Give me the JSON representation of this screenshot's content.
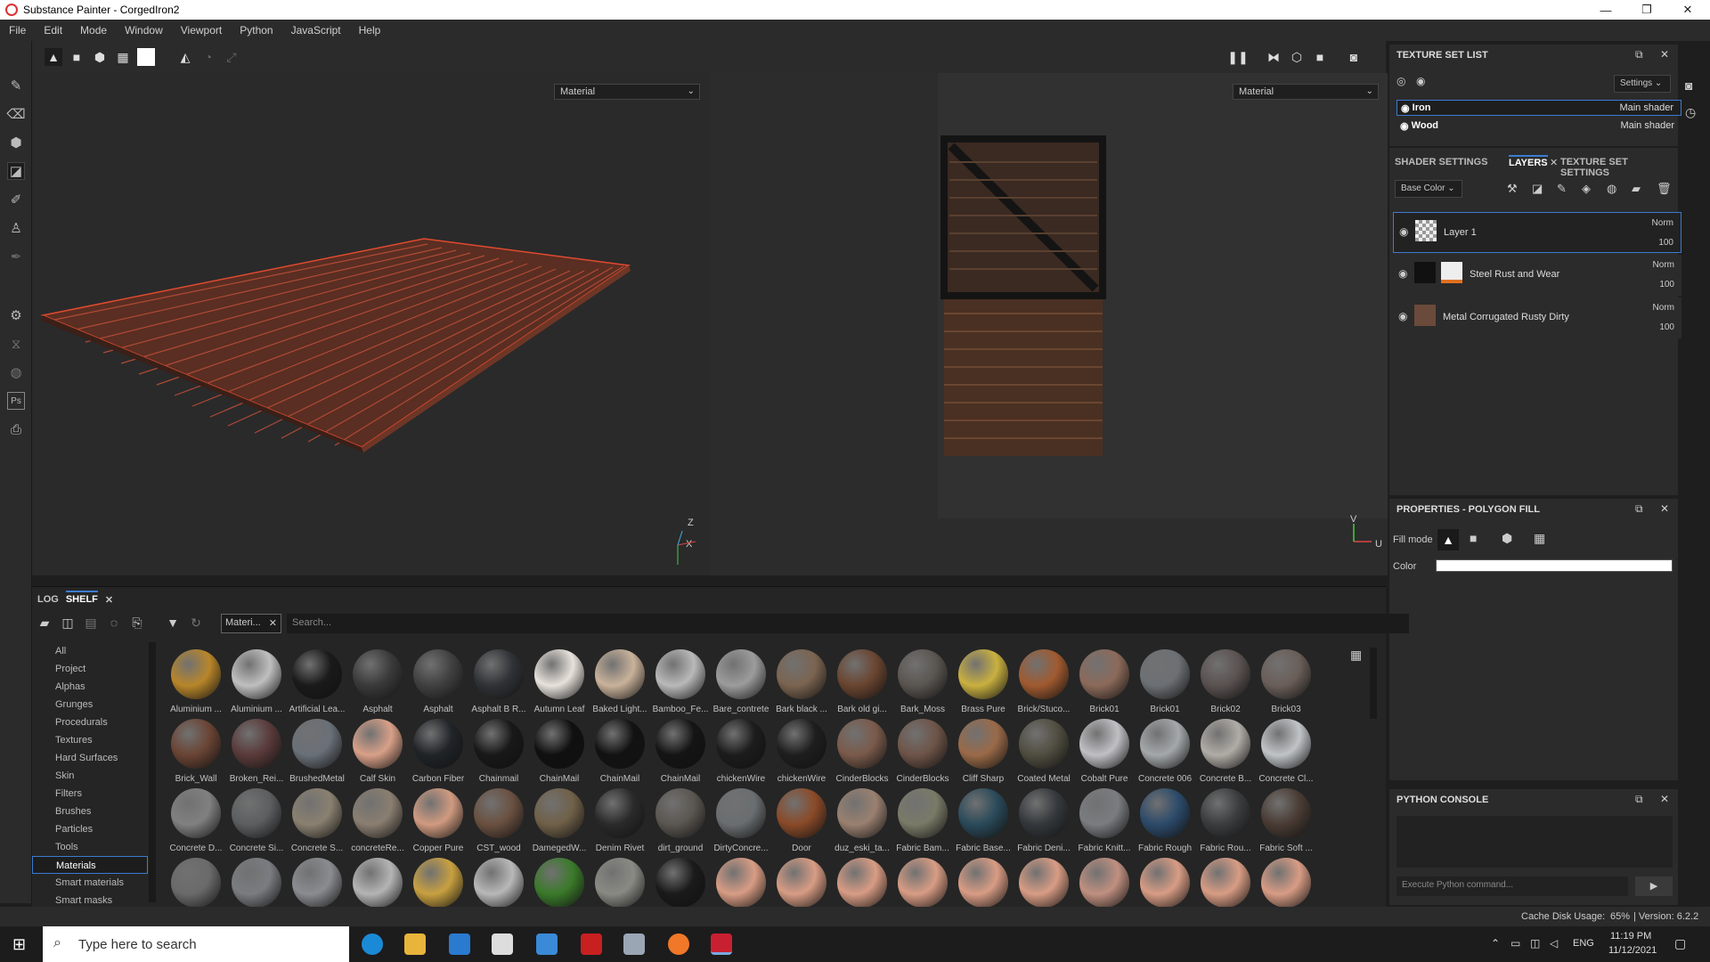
{
  "window": {
    "title": "Substance Painter - CorgedIron2",
    "min": "—",
    "max": "❐",
    "close": "✕"
  },
  "menu": [
    "File",
    "Edit",
    "Mode",
    "Window",
    "Viewport",
    "Python",
    "JavaScript",
    "Help"
  ],
  "viewport3d": {
    "channel": "Material",
    "axis_x": "X",
    "axis_z": "Z"
  },
  "viewport2d": {
    "channel": "Material",
    "axis_u": "U",
    "axis_v": "V"
  },
  "texture_set_list": {
    "title": "TEXTURE SET LIST",
    "settings_label": "Settings",
    "sets": [
      {
        "name": "Iron",
        "shader": "Main shader",
        "selected": true
      },
      {
        "name": "Wood",
        "shader": "Main shader",
        "selected": false
      }
    ]
  },
  "layers_tabs": {
    "shader": "SHADER SETTINGS",
    "layers": "LAYERS",
    "tss": "TEXTURE SET SETTINGS"
  },
  "layers": {
    "channel": "Base Color",
    "items": [
      {
        "name": "Layer 1",
        "blend": "Norm",
        "opacity": "100",
        "selected": true
      },
      {
        "name": "Steel Rust and Wear",
        "blend": "Norm",
        "opacity": "100",
        "selected": false
      },
      {
        "name": "Metal Corrugated Rusty Dirty",
        "blend": "Norm",
        "opacity": "100",
        "selected": false
      }
    ]
  },
  "properties": {
    "title": "PROPERTIES - POLYGON FILL",
    "fill_mode": "Fill mode",
    "color": "Color",
    "color_value": "#ffffff"
  },
  "python_console": {
    "title": "PYTHON CONSOLE",
    "placeholder": "Execute Python command..."
  },
  "shelf": {
    "tabs": {
      "log": "LOG",
      "shelf": "SHELF"
    },
    "filter_chip": "Materi...",
    "search_placeholder": "Search...",
    "categories": [
      "All",
      "Project",
      "Alphas",
      "Grunges",
      "Procedurals",
      "Textures",
      "Hard Surfaces",
      "Skin",
      "Filters",
      "Brushes",
      "Particles",
      "Tools",
      "Materials",
      "Smart materials",
      "Smart masks"
    ],
    "selected_category": "Materials",
    "materials": [
      {
        "name": "Aluminium ...",
        "color": "#b8862a"
      },
      {
        "name": "Aluminium ...",
        "color": "#bfbfbf"
      },
      {
        "name": "Artificial Lea...",
        "color": "#1a1a1a"
      },
      {
        "name": "Asphalt",
        "color": "#3a3a3a"
      },
      {
        "name": "Asphalt",
        "color": "#404040"
      },
      {
        "name": "Asphalt B R...",
        "color": "#2f3236"
      },
      {
        "name": "Autumn Leaf",
        "color": "#e8e2dc"
      },
      {
        "name": "Baked Light...",
        "color": "#c9b29a"
      },
      {
        "name": "Bamboo_Fe...",
        "color": "#b9b9b9"
      },
      {
        "name": "Bare_contrete",
        "color": "#9c9c9c"
      },
      {
        "name": "Bark black ...",
        "color": "#7b6450"
      },
      {
        "name": "Bark old gi...",
        "color": "#6a4530"
      },
      {
        "name": "Bark_Moss",
        "color": "#5a5550"
      },
      {
        "name": "Brass Pure",
        "color": "#c9b040"
      },
      {
        "name": "Brick/Stuco...",
        "color": "#a05a30"
      },
      {
        "name": "Brick01",
        "color": "#8c6a5a"
      },
      {
        "name": "Brick01",
        "color": "#6c7074"
      },
      {
        "name": "Brick02",
        "color": "#5a5250"
      },
      {
        "name": "Brick03",
        "color": "#6a5e58"
      },
      {
        "name": "Brick_Wall",
        "color": "#6a4434"
      },
      {
        "name": "Broken_Rei...",
        "color": "#5a3a3a"
      },
      {
        "name": "BrushedMetal",
        "color": "#6a7078"
      },
      {
        "name": "Calf Skin",
        "color": "#d8a088"
      },
      {
        "name": "Carbon Fiber",
        "color": "#202428"
      },
      {
        "name": "Chainmail",
        "color": "#181818"
      },
      {
        "name": "ChainMail",
        "color": "#101010"
      },
      {
        "name": "ChainMail",
        "color": "#121212"
      },
      {
        "name": "ChainMail",
        "color": "#141414"
      },
      {
        "name": "chickenWire",
        "color": "#1c1c1c"
      },
      {
        "name": "chickenWire",
        "color": "#1e1e1e"
      },
      {
        "name": "CinderBlocks",
        "color": "#7a5a4a"
      },
      {
        "name": "CinderBlocks",
        "color": "#6e5448"
      },
      {
        "name": "Cliff Sharp",
        "color": "#9a6a48"
      },
      {
        "name": "Coated Metal",
        "color": "#504e40"
      },
      {
        "name": "Cobalt Pure",
        "color": "#c0c0c4"
      },
      {
        "name": "Concrete 006",
        "color": "#a4a8aa"
      },
      {
        "name": "Concrete B...",
        "color": "#b0aca6"
      },
      {
        "name": "Concrete Cl...",
        "color": "#c0c4c6"
      },
      {
        "name": "Concrete D...",
        "color": "#808080"
      },
      {
        "name": "Concrete Si...",
        "color": "#5c5e60"
      },
      {
        "name": "Concrete S...",
        "color": "#8a8070"
      },
      {
        "name": "concreteRe...",
        "color": "#8a7e70"
      },
      {
        "name": "Copper Pure",
        "color": "#d09a80"
      },
      {
        "name": "CST_wood",
        "color": "#6a5040"
      },
      {
        "name": "DamegedW...",
        "color": "#706048"
      },
      {
        "name": "Denim Rivet",
        "color": "#2a2a2a"
      },
      {
        "name": "dirt_ground",
        "color": "#5a5650"
      },
      {
        "name": "DirtyConcre...",
        "color": "#6a6e70"
      },
      {
        "name": "Door",
        "color": "#8a4a28"
      },
      {
        "name": "duz_eski_ta...",
        "color": "#9a8070"
      },
      {
        "name": "Fabric Bam...",
        "color": "#7a7a68"
      },
      {
        "name": "Fabric Base...",
        "color": "#2a4a5a"
      },
      {
        "name": "Fabric Deni...",
        "color": "#34383c"
      },
      {
        "name": "Fabric Knitt...",
        "color": "#7a7c80"
      },
      {
        "name": "Fabric Rough",
        "color": "#2c4a6a"
      },
      {
        "name": "Fabric Rou...",
        "color": "#3a3c3e"
      },
      {
        "name": "Fabric Soft ...",
        "color": "#4a3c34"
      },
      {
        "name": "",
        "color": "#6a6a6a"
      },
      {
        "name": "",
        "color": "#7a7c80"
      },
      {
        "name": "",
        "color": "#8a8c90"
      },
      {
        "name": "",
        "color": "#b4b4b4"
      },
      {
        "name": "",
        "color": "#c8a040"
      },
      {
        "name": "",
        "color": "#b8b8b8"
      },
      {
        "name": "",
        "color": "#3a7a2a"
      },
      {
        "name": "",
        "color": "#8a8a84"
      },
      {
        "name": "",
        "color": "#1a1a1a"
      },
      {
        "name": "",
        "color": "#d89c84"
      },
      {
        "name": "",
        "color": "#d89c84"
      },
      {
        "name": "",
        "color": "#d89c84"
      },
      {
        "name": "",
        "color": "#d89c84"
      },
      {
        "name": "",
        "color": "#d89c84"
      },
      {
        "name": "",
        "color": "#d89c84"
      },
      {
        "name": "",
        "color": "#c09080"
      },
      {
        "name": "",
        "color": "#d89c84"
      },
      {
        "name": "",
        "color": "#d89c84"
      },
      {
        "name": "",
        "color": "#d89c84"
      }
    ]
  },
  "status": {
    "cache": "Cache Disk Usage:",
    "cache_value": "65%",
    "version": "| Version: 6.2.2"
  },
  "taskbar": {
    "search_placeholder": "Type here to search",
    "lang": "ENG",
    "time": "11:19 PM",
    "date": "11/12/2021"
  }
}
